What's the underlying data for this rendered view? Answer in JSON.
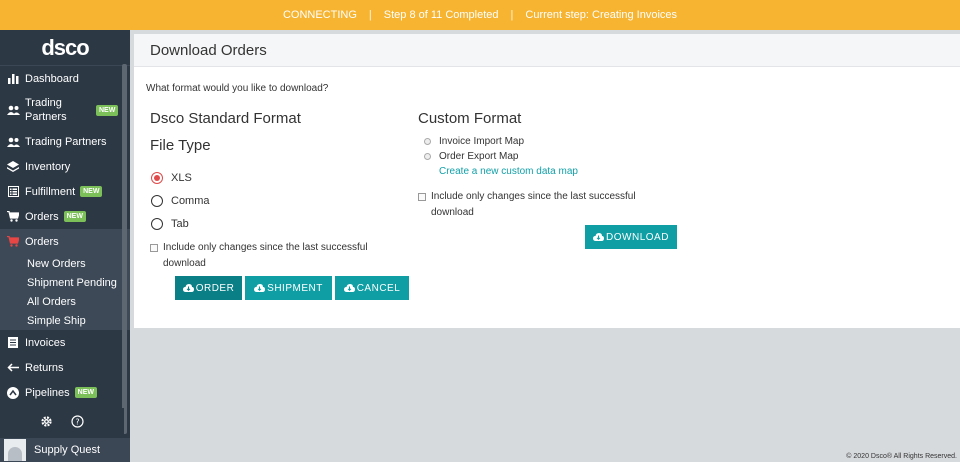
{
  "status_bar": {
    "connecting": "CONNECTING",
    "progress": "Step 8 of 11 Completed",
    "current_step": "Current step: Creating Invoices"
  },
  "sidebar": {
    "brand": "dsco",
    "items": [
      {
        "label": "Dashboard",
        "icon": "bar-chart-icon"
      },
      {
        "label": "Trading Partners",
        "icon": "people-icon",
        "badge": "NEW"
      },
      {
        "label": "Trading Partners",
        "icon": "people-icon"
      },
      {
        "label": "Inventory",
        "icon": "layers-icon"
      },
      {
        "label": "Fulfillment",
        "icon": "list-icon",
        "badge": "NEW"
      },
      {
        "label": "Orders",
        "icon": "cart-icon",
        "badge": "NEW"
      },
      {
        "label": "Orders",
        "icon": "cart-icon"
      }
    ],
    "sub_items": [
      "New Orders",
      "Shipment Pending",
      "All Orders",
      "Simple Ship"
    ],
    "items_after": [
      {
        "label": "Invoices",
        "icon": "invoice-icon"
      },
      {
        "label": "Returns",
        "icon": "return-arrow-icon"
      },
      {
        "label": "Pipelines",
        "icon": "pipeline-icon",
        "badge": "NEW"
      }
    ],
    "user": "Supply Quest",
    "accent_color": "#e84545",
    "badge_color": "#7cc05a"
  },
  "panel": {
    "title": "Download Orders",
    "question": "What format would you like to download?",
    "standard": {
      "heading": "Dsco Standard Format",
      "file_type_heading": "File Type",
      "options": [
        "XLS",
        "Comma",
        "Tab"
      ],
      "selected": "XLS",
      "changes_label_1": "Include only changes since the last successful",
      "changes_label_2": "download",
      "buttons": [
        "ORDER",
        "SHIPMENT",
        "CANCEL"
      ]
    },
    "custom": {
      "heading": "Custom Format",
      "options": [
        "Invoice Import Map",
        "Order Export Map"
      ],
      "create_link": "Create a new custom data map",
      "changes_label_1": "Include only changes since the last successful",
      "changes_label_2": "download",
      "download_button": "DOWNLOAD"
    }
  },
  "footer": "© 2020 Dsco® All Rights Reserved.",
  "colors": {
    "topbar": "#f6b431",
    "sidebar": "#2d3845",
    "button": "#0e9ea4"
  }
}
